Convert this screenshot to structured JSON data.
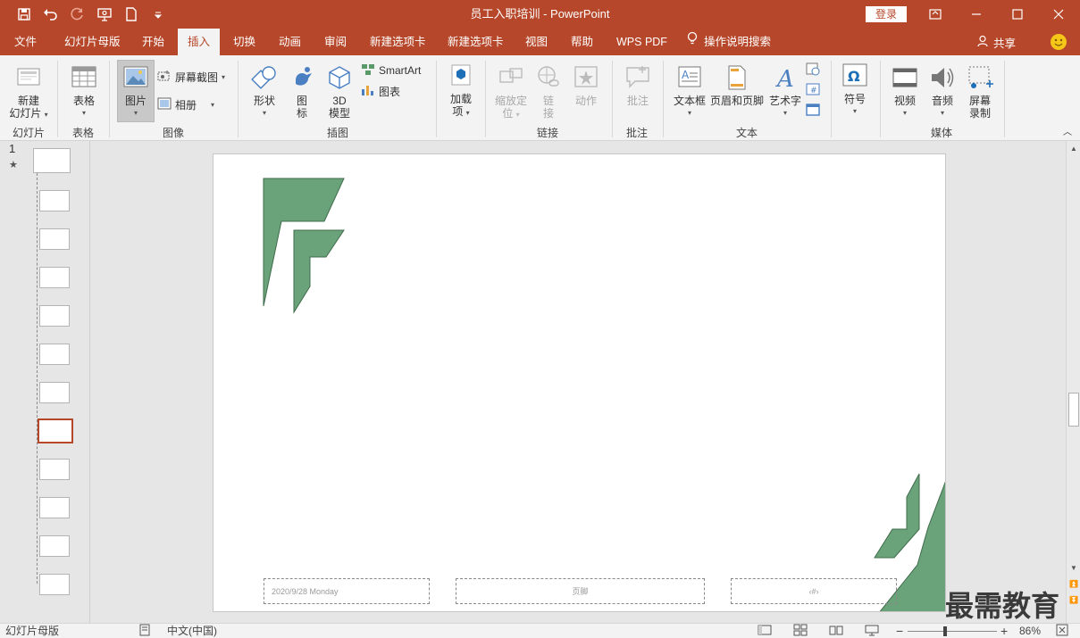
{
  "app": {
    "title": "员工入职培训  -  PowerPoint",
    "login_label": "登录"
  },
  "tabs": [
    {
      "label": "文件"
    },
    {
      "label": "幻灯片母版"
    },
    {
      "label": "开始"
    },
    {
      "label": "插入"
    },
    {
      "label": "切换"
    },
    {
      "label": "动画"
    },
    {
      "label": "审阅"
    },
    {
      "label": "新建选项卡"
    },
    {
      "label": "新建选项卡"
    },
    {
      "label": "视图"
    },
    {
      "label": "帮助"
    },
    {
      "label": "WPS PDF"
    }
  ],
  "tell_me": "操作说明搜索",
  "share_label": "共享",
  "ribbon": {
    "new_slide": [
      "新建",
      "幻灯片"
    ],
    "table": "表格",
    "picture": "图片",
    "screenshot": "屏幕截图",
    "album": "相册",
    "shapes": "形状",
    "icons": [
      "图",
      "标"
    ],
    "model3d": [
      "3D",
      "模型"
    ],
    "smartart": "SmartArt",
    "chart": "图表",
    "addins": [
      "加载",
      "项"
    ],
    "zoom": [
      "缩放定",
      "位"
    ],
    "link": [
      "链",
      "接"
    ],
    "action": "动作",
    "comment": "批注",
    "textbox": "文本框",
    "header_footer": "页眉和页脚",
    "wordart": "艺术字",
    "symbol": "符号",
    "video": "视频",
    "audio": "音频",
    "screen_rec": [
      "屏幕",
      "录制"
    ],
    "groups": {
      "slides": "幻灯片",
      "tables": "表格",
      "images": "图像",
      "illustrations": "插图",
      "links": "链接",
      "comments": "批注",
      "text": "文本",
      "symbols": "",
      "media": "媒体"
    }
  },
  "thumbs": {
    "master_number": "1",
    "master_star": "★"
  },
  "slide": {
    "date_text": "2020/9/28 Monday",
    "footer_text": "页脚",
    "num_text": "‹#›"
  },
  "status": {
    "view_label": "幻灯片母版",
    "language": "中文(中国)",
    "zoom": "86%"
  },
  "watermark": "最需教育",
  "colors": {
    "accent": "#b7472a",
    "logo_green": "#6aa37a"
  }
}
